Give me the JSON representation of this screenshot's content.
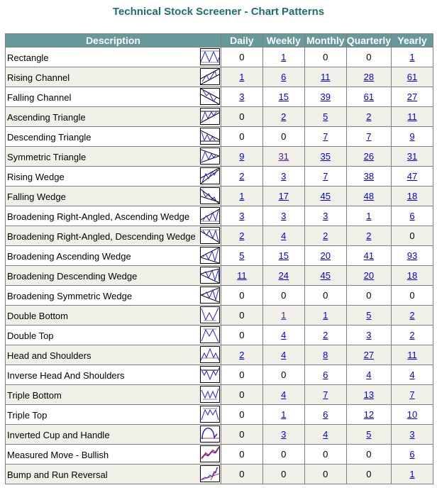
{
  "title": "Technical Stock Screener - Chart Patterns",
  "columns": [
    "Description",
    "Daily",
    "Weekly",
    "Monthly",
    "Quarterly",
    "Yearly"
  ],
  "link_colors": {
    "link": "#0000ee",
    "visited": "#551a8b"
  },
  "header_color": "#669999",
  "shade_color": "#f1f0e8",
  "rows": [
    {
      "label": "Rectangle",
      "icon": "rectangle-pattern-icon",
      "values": [
        "0",
        "1",
        "0",
        "0",
        "1"
      ],
      "links": [
        false,
        true,
        false,
        false,
        true
      ],
      "visited": [
        false,
        false,
        false,
        false,
        false
      ]
    },
    {
      "label": "Rising Channel",
      "icon": "rising-channel-pattern-icon",
      "values": [
        "1",
        "6",
        "11",
        "28",
        "61"
      ],
      "links": [
        true,
        true,
        true,
        true,
        true
      ],
      "visited": [
        false,
        false,
        false,
        false,
        false
      ]
    },
    {
      "label": "Falling Channel",
      "icon": "falling-channel-pattern-icon",
      "values": [
        "3",
        "15",
        "39",
        "61",
        "27"
      ],
      "links": [
        true,
        true,
        true,
        true,
        true
      ],
      "visited": [
        false,
        false,
        false,
        false,
        false
      ]
    },
    {
      "label": "Ascending Triangle",
      "icon": "ascending-triangle-pattern-icon",
      "values": [
        "0",
        "2",
        "5",
        "2",
        "11"
      ],
      "links": [
        false,
        true,
        true,
        true,
        true
      ],
      "visited": [
        false,
        false,
        false,
        false,
        false
      ]
    },
    {
      "label": "Descending Triangle",
      "icon": "descending-triangle-pattern-icon",
      "values": [
        "0",
        "0",
        "7",
        "7",
        "9"
      ],
      "links": [
        false,
        false,
        true,
        true,
        true
      ],
      "visited": [
        false,
        false,
        false,
        false,
        false
      ]
    },
    {
      "label": "Symmetric Triangle",
      "icon": "symmetric-triangle-pattern-icon",
      "values": [
        "9",
        "31",
        "35",
        "26",
        "31"
      ],
      "links": [
        true,
        true,
        true,
        true,
        true
      ],
      "visited": [
        false,
        true,
        false,
        false,
        false
      ]
    },
    {
      "label": "Rising Wedge",
      "icon": "rising-wedge-pattern-icon",
      "values": [
        "2",
        "3",
        "7",
        "38",
        "47"
      ],
      "links": [
        true,
        true,
        true,
        true,
        true
      ],
      "visited": [
        false,
        false,
        false,
        false,
        false
      ]
    },
    {
      "label": "Falling Wedge",
      "icon": "falling-wedge-pattern-icon",
      "values": [
        "1",
        "17",
        "45",
        "48",
        "18"
      ],
      "links": [
        true,
        true,
        true,
        true,
        true
      ],
      "visited": [
        false,
        false,
        false,
        false,
        false
      ]
    },
    {
      "label": "Broadening Right-Angled, Ascending Wedge",
      "icon": "broadening-right-angled-ascending-wedge-icon",
      "values": [
        "3",
        "3",
        "3",
        "1",
        "6"
      ],
      "links": [
        true,
        true,
        true,
        true,
        true
      ],
      "visited": [
        false,
        false,
        false,
        false,
        false
      ]
    },
    {
      "label": "Broadening Right-Angled, Descending Wedge",
      "icon": "broadening-right-angled-descending-wedge-icon",
      "values": [
        "2",
        "4",
        "2",
        "2",
        "0"
      ],
      "links": [
        true,
        true,
        true,
        true,
        false
      ],
      "visited": [
        false,
        false,
        false,
        false,
        false
      ]
    },
    {
      "label": "Broadening Ascending Wedge",
      "icon": "broadening-ascending-wedge-icon",
      "values": [
        "5",
        "15",
        "20",
        "41",
        "93"
      ],
      "links": [
        true,
        true,
        true,
        true,
        true
      ],
      "visited": [
        false,
        false,
        false,
        false,
        false
      ]
    },
    {
      "label": "Broadening Descending Wedge",
      "icon": "broadening-descending-wedge-icon",
      "values": [
        "11",
        "24",
        "45",
        "20",
        "18"
      ],
      "links": [
        true,
        true,
        true,
        true,
        true
      ],
      "visited": [
        false,
        false,
        false,
        false,
        false
      ]
    },
    {
      "label": "Broadening Symmetric Wedge",
      "icon": "broadening-symmetric-wedge-icon",
      "values": [
        "0",
        "0",
        "0",
        "0",
        "0"
      ],
      "links": [
        false,
        false,
        false,
        false,
        false
      ],
      "visited": [
        false,
        false,
        false,
        false,
        false
      ]
    },
    {
      "label": "Double Bottom",
      "icon": "double-bottom-pattern-icon",
      "values": [
        "0",
        "1",
        "1",
        "5",
        "2"
      ],
      "links": [
        false,
        true,
        true,
        true,
        true
      ],
      "visited": [
        false,
        true,
        false,
        false,
        false
      ]
    },
    {
      "label": "Double Top",
      "icon": "double-top-pattern-icon",
      "values": [
        "0",
        "4",
        "2",
        "3",
        "2"
      ],
      "links": [
        false,
        true,
        true,
        true,
        true
      ],
      "visited": [
        false,
        false,
        false,
        false,
        false
      ]
    },
    {
      "label": "Head and Shoulders",
      "icon": "head-and-shoulders-pattern-icon",
      "values": [
        "2",
        "4",
        "8",
        "27",
        "11"
      ],
      "links": [
        true,
        true,
        true,
        true,
        true
      ],
      "visited": [
        false,
        false,
        false,
        false,
        false
      ]
    },
    {
      "label": "Inverse Head And Shoulders",
      "icon": "inverse-head-and-shoulders-pattern-icon",
      "values": [
        "0",
        "0",
        "6",
        "4",
        "4"
      ],
      "links": [
        false,
        false,
        true,
        true,
        true
      ],
      "visited": [
        false,
        false,
        false,
        false,
        false
      ]
    },
    {
      "label": "Triple Bottom",
      "icon": "triple-bottom-pattern-icon",
      "values": [
        "0",
        "4",
        "7",
        "13",
        "7"
      ],
      "links": [
        false,
        true,
        true,
        true,
        true
      ],
      "visited": [
        false,
        false,
        false,
        false,
        false
      ]
    },
    {
      "label": "Triple Top",
      "icon": "triple-top-pattern-icon",
      "values": [
        "0",
        "1",
        "6",
        "12",
        "10"
      ],
      "links": [
        false,
        true,
        true,
        true,
        true
      ],
      "visited": [
        false,
        false,
        false,
        false,
        false
      ]
    },
    {
      "label": "Inverted Cup and Handle",
      "icon": "inverted-cup-and-handle-pattern-icon",
      "values": [
        "0",
        "3",
        "4",
        "5",
        "3"
      ],
      "links": [
        false,
        true,
        true,
        true,
        true
      ],
      "visited": [
        false,
        false,
        false,
        false,
        false
      ]
    },
    {
      "label": "Measured Move - Bullish",
      "icon": "measured-move-bullish-pattern-icon",
      "values": [
        "0",
        "0",
        "0",
        "0",
        "6"
      ],
      "links": [
        false,
        false,
        false,
        false,
        true
      ],
      "visited": [
        false,
        false,
        false,
        false,
        false
      ]
    },
    {
      "label": "Bump and Run Reversal",
      "icon": "bump-and-run-reversal-pattern-icon",
      "values": [
        "0",
        "0",
        "0",
        "0",
        "1"
      ],
      "links": [
        false,
        false,
        false,
        false,
        true
      ],
      "visited": [
        false,
        false,
        false,
        false,
        false
      ]
    }
  ]
}
